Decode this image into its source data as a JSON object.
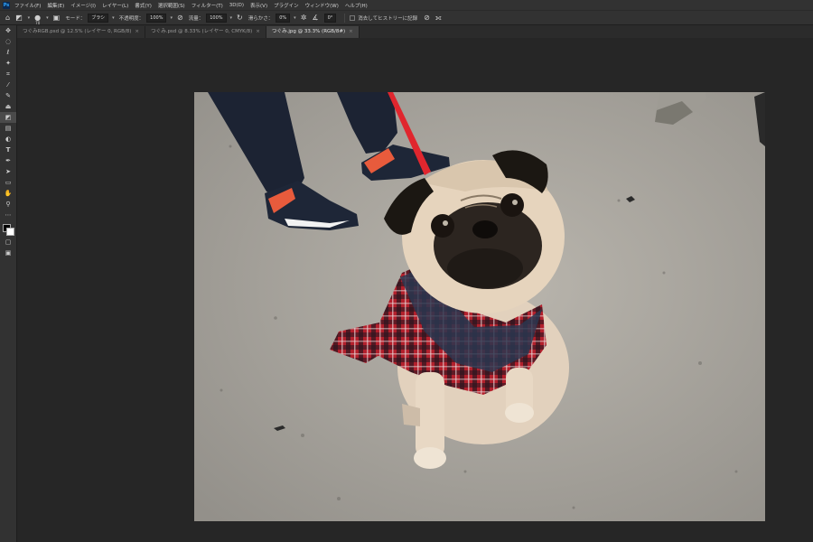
{
  "menubar": {
    "app_logo": "Ps",
    "items": [
      "ファイル(F)",
      "編集(E)",
      "イメージ(I)",
      "レイヤー(L)",
      "書式(Y)",
      "選択範囲(S)",
      "フィルター(T)",
      "3D(D)",
      "表示(V)",
      "プラグイン",
      "ウィンドウ(W)",
      "ヘルプ(H)"
    ]
  },
  "options": {
    "brush_size": "70",
    "mode_label": "モード：",
    "mode_value": "ブラシ",
    "opacity_label": "不透明度：",
    "opacity_value": "100%",
    "flow_label": "流量：",
    "flow_value": "100%",
    "smoothing_label": "滑らかさ：",
    "smoothing_value": "0%",
    "angle_value": "0°",
    "history_label": "消去してヒストリーに記録"
  },
  "tabs": [
    {
      "label": "つぐみRGB.psd @ 12.5% (レイヤー 0, RGB/8)"
    },
    {
      "label": "つぐみ.psd @ 8.33% (レイヤー 0, CMYK/8)"
    },
    {
      "label": "つぐみ.jpg @ 33.3% (RGB/8#)"
    }
  ],
  "colors": {
    "foreground": "#000000",
    "background": "#ffffff"
  },
  "tools": [
    "move-icon",
    "marquee-icon",
    "lasso-icon",
    "magic-wand-icon",
    "crop-icon",
    "eyedropper-icon",
    "brush-icon",
    "stamp-icon",
    "eraser-icon",
    "gradient-icon",
    "dodge-icon",
    "type-icon",
    "pen-icon",
    "path-select-icon",
    "shape-icon",
    "hand-icon",
    "zoom-icon",
    "more-icon"
  ]
}
